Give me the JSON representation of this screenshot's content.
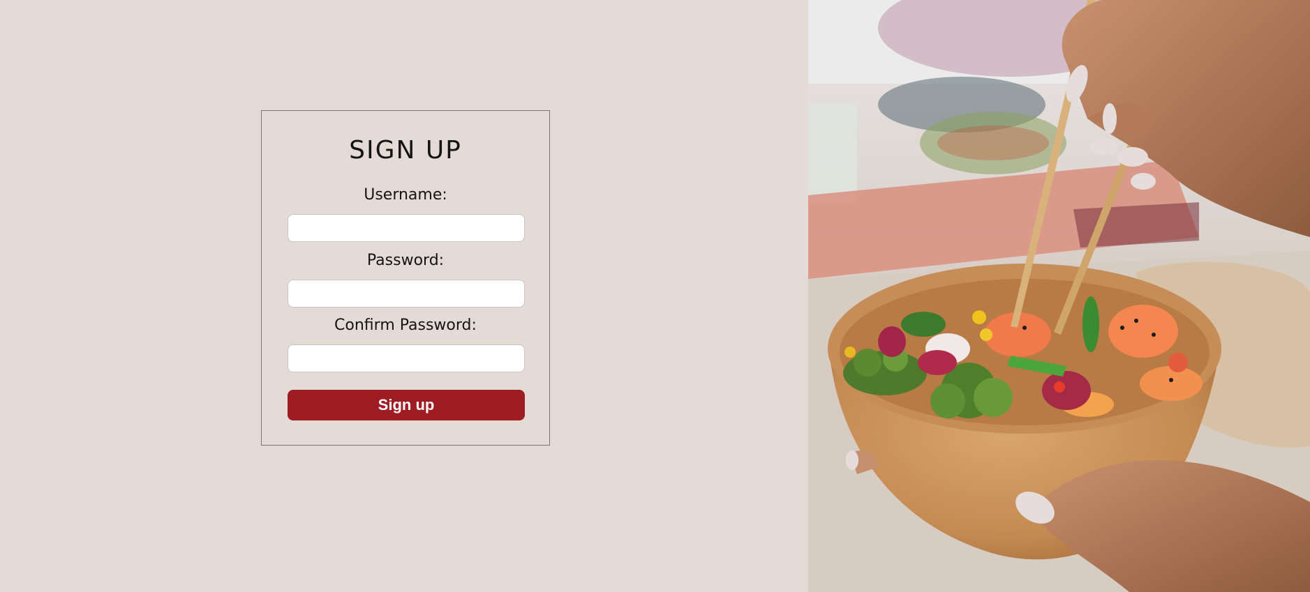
{
  "form": {
    "title": "SIGN UP",
    "username_label": "Username:",
    "username_value": "",
    "password_label": "Password:",
    "password_value": "",
    "confirm_label": "Confirm Password:",
    "confirm_value": "",
    "submit_label": "Sign up"
  },
  "colors": {
    "background": "#e5dbd6",
    "button": "#9e1d22",
    "card_border": "#7b7573"
  },
  "hero_image": {
    "subject": "poke-bowl-with-chopsticks-photo"
  }
}
